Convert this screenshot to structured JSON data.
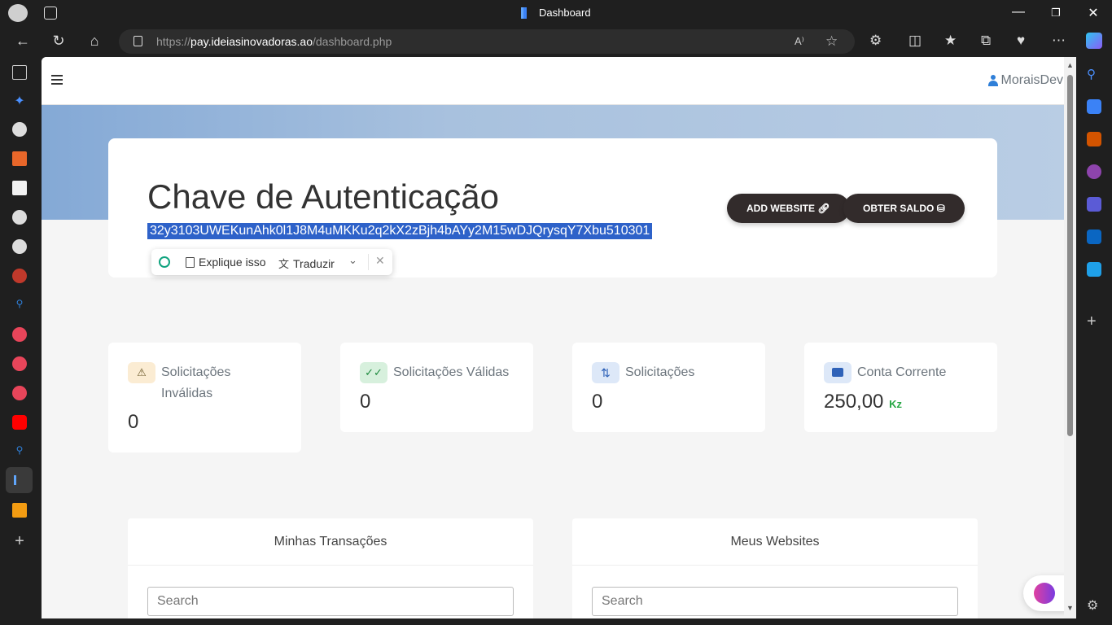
{
  "browser": {
    "title": "Dashboard",
    "url_scheme": "https://",
    "url_host": "pay.ideiasinovadoras.ao",
    "url_path": "/dashboard.php",
    "read_aloud_icon": "A⁾"
  },
  "topnav": {
    "username": "MoraisDev"
  },
  "auth": {
    "title": "Chave de Autenticação",
    "key": "32y3103UWEKunAhk0l1J8M4uMKKu2q2kX2zBjh4bAYy2M15wDJQrysqY7Xbu510301",
    "add_website_label": "ADD WEBSITE",
    "get_balance_label": "OBTER SALDO"
  },
  "popup": {
    "explain_label": "Explique isso",
    "translate_label": "Traduzir"
  },
  "stats": {
    "invalid": {
      "label_line1": "Solicitações",
      "label_line2": "Inválidas",
      "value": "0"
    },
    "valid": {
      "label": "Solicitações Válidas",
      "value": "0"
    },
    "requests": {
      "label": "Solicitações",
      "value": "0"
    },
    "account": {
      "label": "Conta Corrente",
      "value": "250,00",
      "currency": "Kz"
    }
  },
  "panels": {
    "transactions": {
      "title": "Minhas Transações",
      "search_placeholder": "Search"
    },
    "websites": {
      "title": "Meus Websites",
      "search_placeholder": "Search"
    }
  },
  "colors": {
    "accent": "#2e62c9",
    "button_dark": "#322b2b",
    "currency_green": "#28a745",
    "warning_bg": "#fbecd3",
    "success_bg": "#d7f0dd",
    "info_bg": "#dde8f8"
  }
}
